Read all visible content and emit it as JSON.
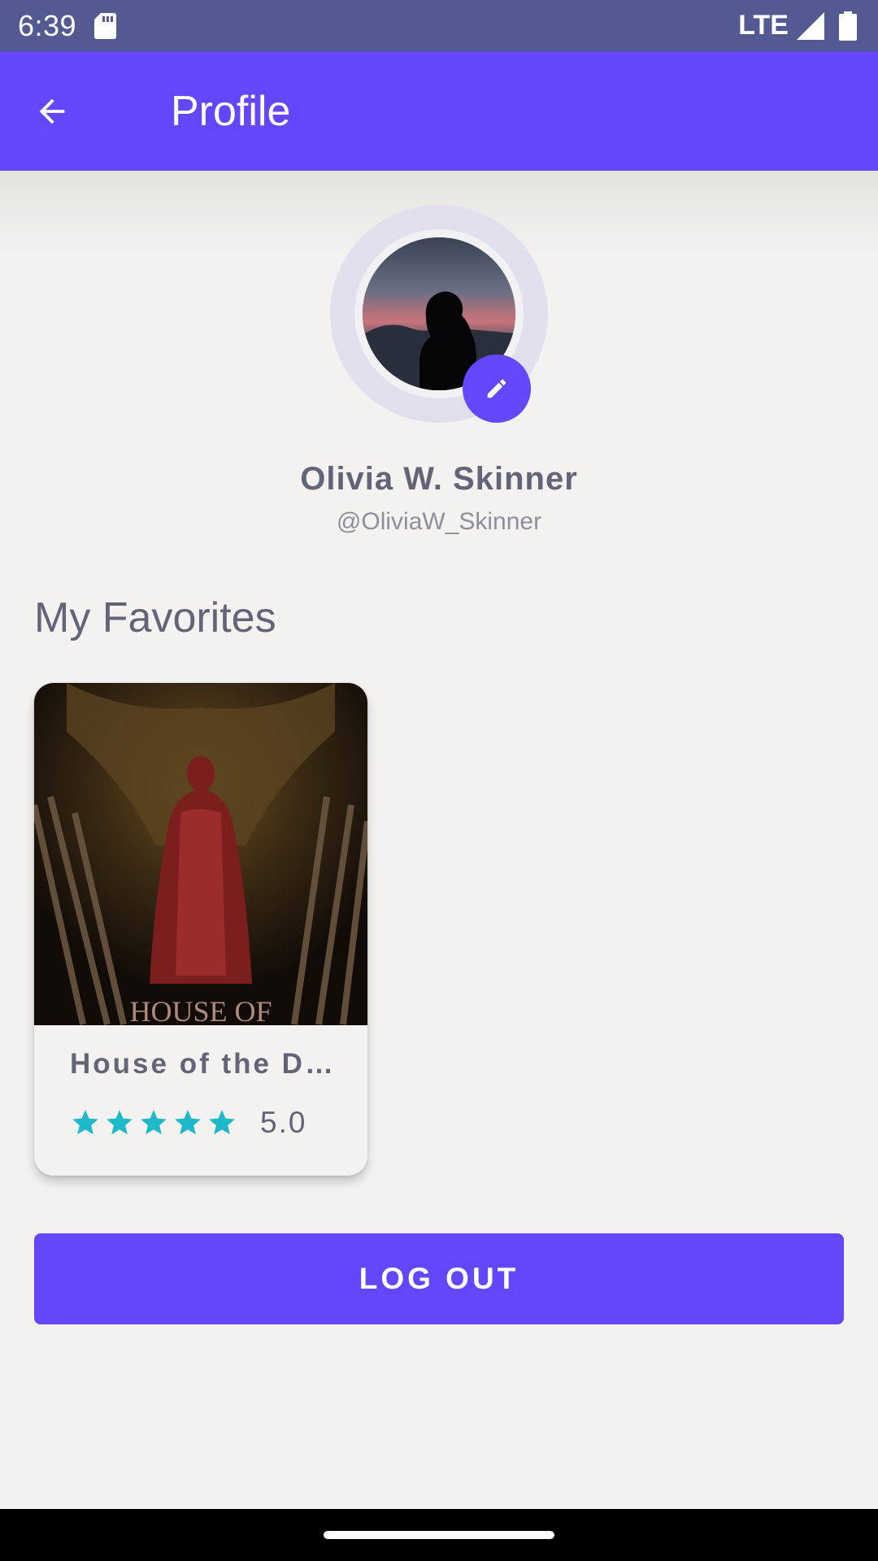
{
  "status_bar": {
    "time": "6:39",
    "network": "LTE",
    "icons": [
      "sd-card-icon",
      "signal-icon",
      "battery-icon"
    ]
  },
  "app_bar": {
    "title": "Profile",
    "back_icon": "arrow-back-icon"
  },
  "profile": {
    "name": "Olivia W. Skinner",
    "handle": "@OliviaW_Skinner",
    "edit_icon": "pencil-icon"
  },
  "favorites": {
    "section_title": "My Favorites",
    "items": [
      {
        "title": "House of the D…",
        "rating": "5.0",
        "stars": 5,
        "poster_text": "HOUSE OF"
      }
    ]
  },
  "actions": {
    "logout_label": "LOG OUT"
  },
  "colors": {
    "primary": "#6447fc",
    "status_bar": "#525a91",
    "background": "#f3f2f0",
    "text": "#646478",
    "star": "#1fb8c8"
  }
}
